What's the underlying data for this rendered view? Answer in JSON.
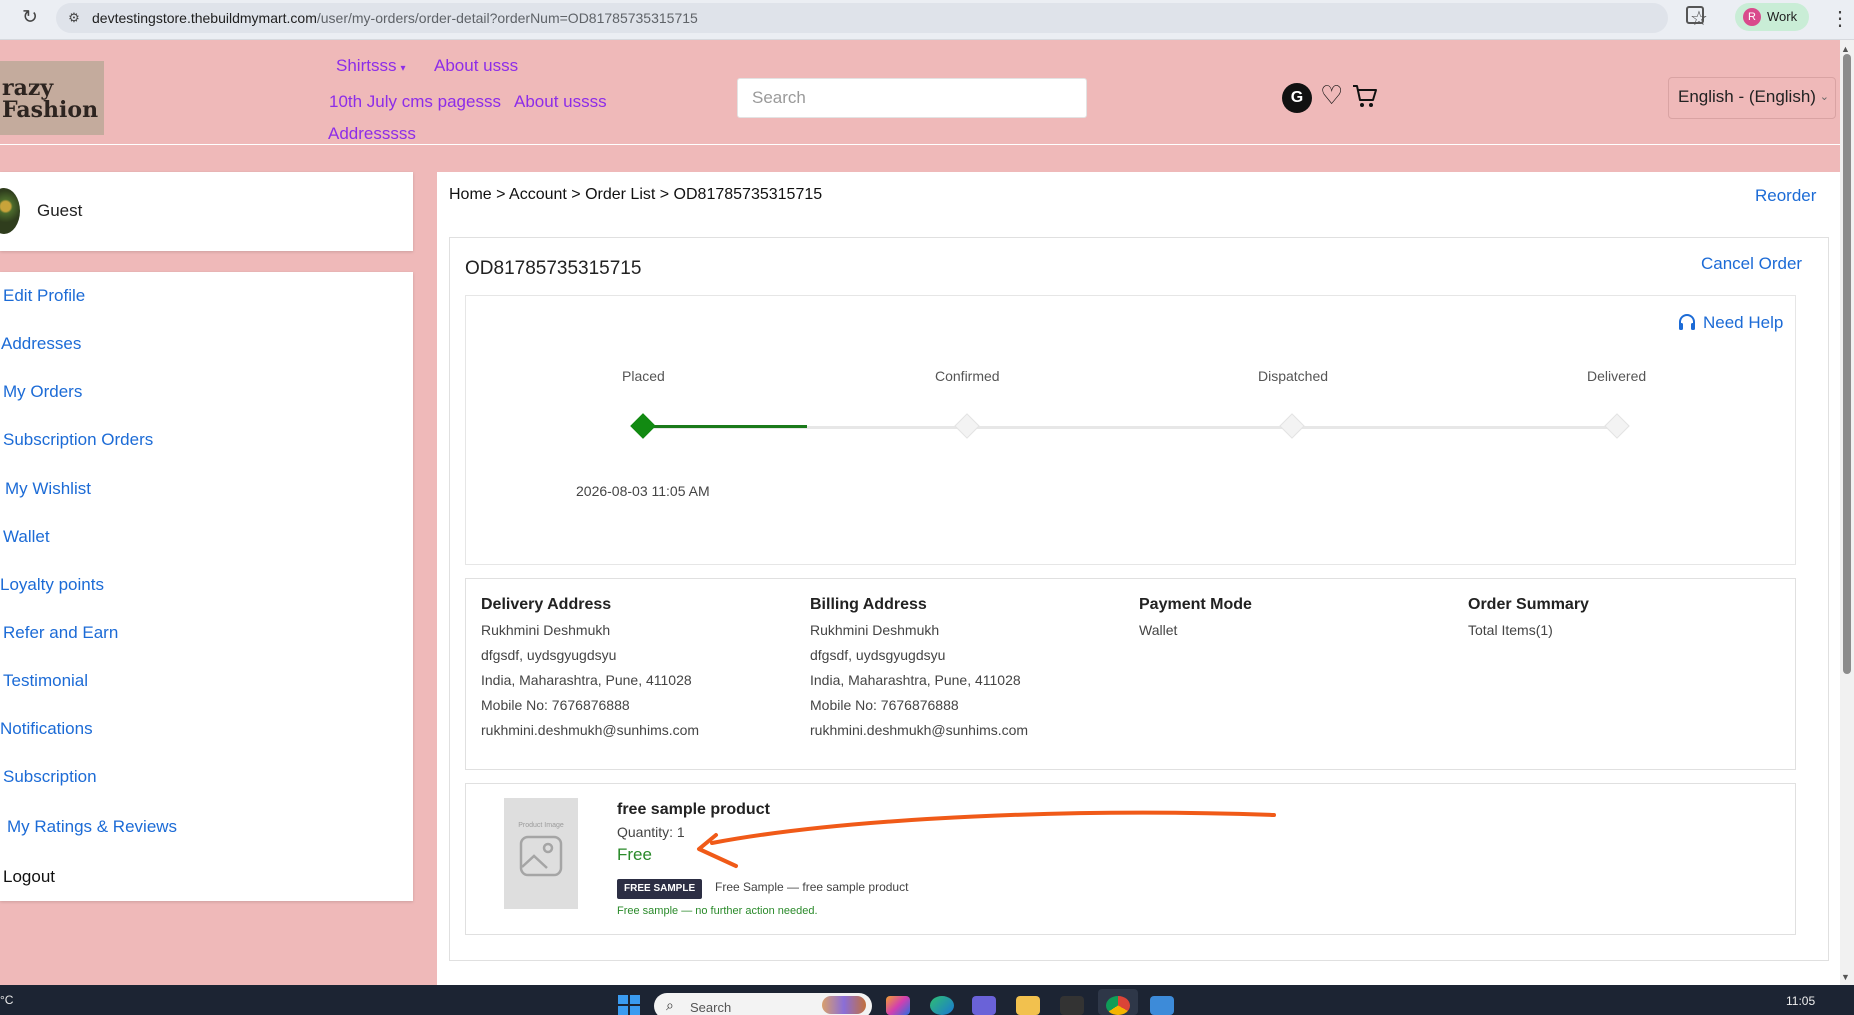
{
  "browser": {
    "url_host": "devtestingstore.thebuildmymart.com",
    "url_path": "/user/my-orders/order-detail?orderNum=OD81785735315715",
    "profile_initial": "R",
    "profile_label": "Work"
  },
  "header": {
    "logo_line1": "razy",
    "logo_line2": "Fashion",
    "nav": {
      "shirts": "Shirtsss",
      "about1": "About usss",
      "cms": "10th July cms pagesss",
      "about2": "About ussss",
      "address": "Addresssss"
    },
    "search_placeholder": "Search",
    "avatar_initial": "G",
    "language": "English - (English)"
  },
  "sidebar": {
    "user_name": "Guest",
    "items": [
      "Edit Profile",
      "Addresses",
      "My Orders",
      "Subscription Orders",
      "My Wishlist",
      "Wallet",
      "Loyalty points",
      "Refer and Earn",
      "Testimonial",
      "Notifications",
      "Subscription",
      "My Ratings & Reviews",
      "Logout"
    ]
  },
  "main": {
    "breadcrumb": "Home > Account > Order List > OD81785735315715",
    "reorder": "Reorder",
    "order_id": "OD81785735315715",
    "cancel_order": "Cancel Order",
    "need_help": "Need Help",
    "tracker": {
      "steps": [
        "Placed",
        "Confirmed",
        "Dispatched",
        "Delivered"
      ],
      "completed_steps": 1,
      "placed_date": "2026-08-03 11:05 AM"
    },
    "delivery_address": {
      "heading": "Delivery Address",
      "lines": [
        "Rukhmini Deshmukh",
        "dfgsdf, uydsgyugdsyu",
        "India, Maharashtra, Pune, 411028",
        "Mobile No: 7676876888",
        "rukhmini.deshmukh@sunhims.com"
      ]
    },
    "billing_address": {
      "heading": "Billing Address",
      "lines": [
        "Rukhmini Deshmukh",
        "dfgsdf, uydsgyugdsyu",
        "India, Maharashtra, Pune, 411028",
        "Mobile No: 7676876888",
        "rukhmini.deshmukh@sunhims.com"
      ]
    },
    "payment": {
      "heading": "Payment Mode",
      "value": "Wallet"
    },
    "summary": {
      "heading": "Order Summary",
      "value": "Total Items(1)"
    },
    "product": {
      "image_placeholder": "Product Image",
      "name": "free sample product",
      "quantity": "Quantity: 1",
      "price": "Free",
      "badge": "FREE SAMPLE",
      "badge_desc": "Free Sample — free sample product",
      "note": "Free sample — no further action needed."
    }
  },
  "taskbar": {
    "weather": "°C",
    "search": "Search",
    "time": "11:05"
  },
  "colors": {
    "page_bg": "#efb9b9",
    "link": "#1c6bd6",
    "nav_link": "#8d2de8",
    "progress": "#128a12",
    "annotation": "#f05a18"
  }
}
